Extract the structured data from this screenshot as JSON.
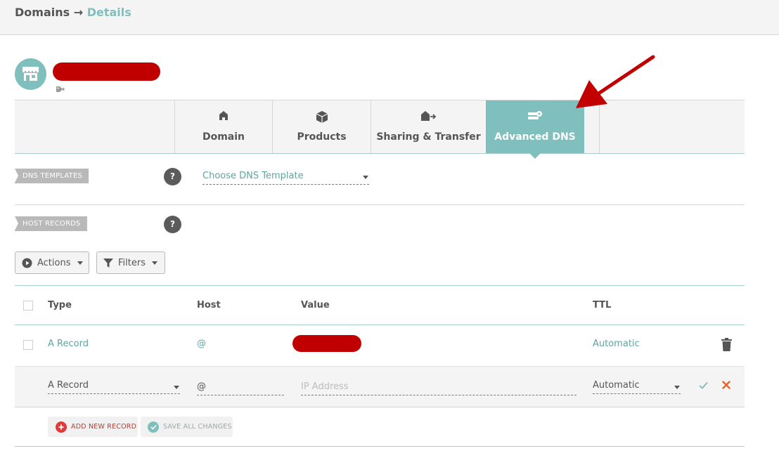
{
  "breadcrumb": {
    "parent": "Domains",
    "separator": "→",
    "current": "Details"
  },
  "tabs": [
    {
      "label": "Domain",
      "icon": "home-icon"
    },
    {
      "label": "Products",
      "icon": "box-icon"
    },
    {
      "label": "Sharing & Transfer",
      "icon": "house-transfer-icon"
    },
    {
      "label": "Advanced DNS",
      "icon": "server-settings-icon",
      "active": true
    }
  ],
  "dns_templates": {
    "label": "DNS TEMPLATES",
    "help": "?",
    "select_value": "Choose DNS Template"
  },
  "host_records": {
    "label": "HOST RECORDS",
    "help": "?"
  },
  "toolbar": {
    "actions_label": "Actions",
    "filters_label": "Filters"
  },
  "table": {
    "columns": [
      "Type",
      "Host",
      "Value",
      "TTL"
    ],
    "rows": [
      {
        "type": "A Record",
        "host": "@",
        "value": "",
        "ttl": "Automatic"
      }
    ],
    "edit_row": {
      "type": "A Record",
      "host": "@",
      "value_placeholder": "IP Address",
      "ttl": "Automatic"
    }
  },
  "footer": {
    "add_label": "ADD NEW RECORD",
    "save_label": "SAVE ALL CHANGES"
  },
  "colors": {
    "accent": "#7fbfbd",
    "redaction": "#c00000",
    "danger": "#e03b3b",
    "cancel": "#e8632b",
    "success": "#7fbfbd"
  }
}
